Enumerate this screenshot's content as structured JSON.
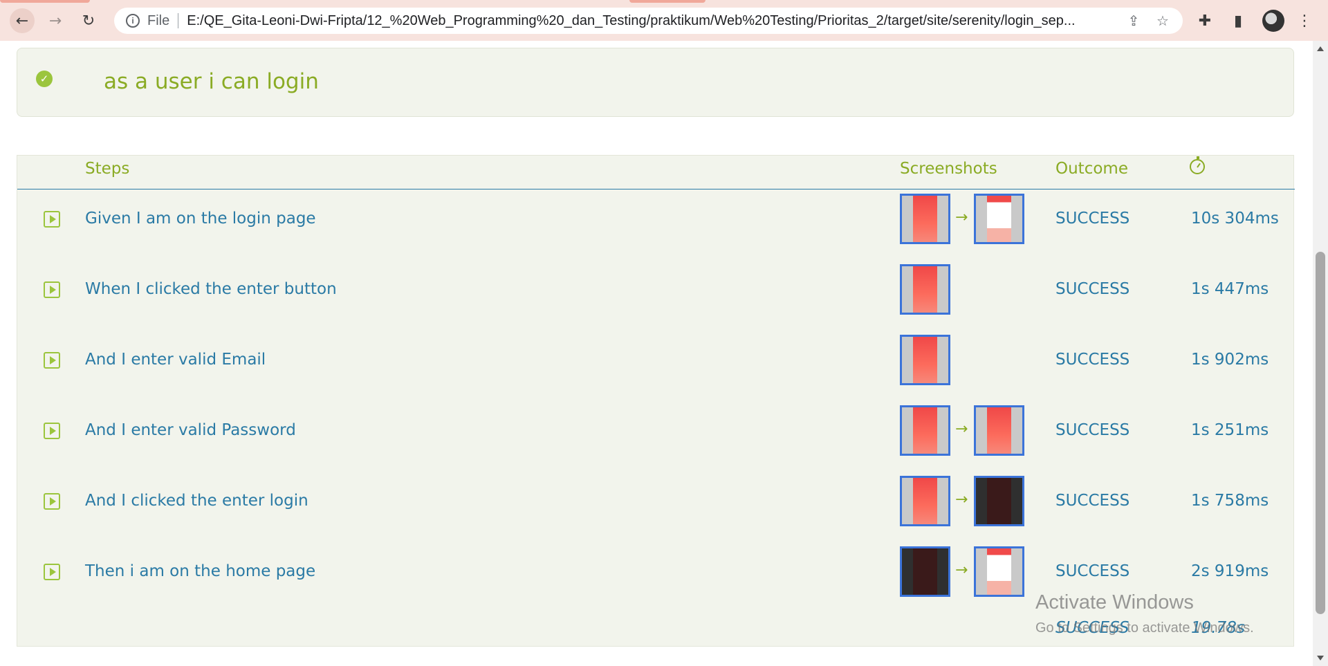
{
  "browser": {
    "file_label": "File",
    "url": "E:/QE_Gita-Leoni-Dwi-Fripta/12_%20Web_Programming%20_dan_Testing/praktikum/Web%20Testing/Prioritas_2/target/site/serenity/login_sep..."
  },
  "scenario": {
    "title": "as a user i can login"
  },
  "table": {
    "headers": {
      "steps": "Steps",
      "screenshots": "Screenshots",
      "outcome": "Outcome"
    },
    "rows": [
      {
        "step": "Given I am on the login page",
        "outcome": "SUCCESS",
        "duration": "10s 304ms"
      },
      {
        "step": "When I clicked the enter button",
        "outcome": "SUCCESS",
        "duration": "1s 447ms"
      },
      {
        "step": "And I enter valid Email",
        "outcome": "SUCCESS",
        "duration": "1s 902ms"
      },
      {
        "step": "And I enter valid Password",
        "outcome": "SUCCESS",
        "duration": "1s 251ms"
      },
      {
        "step": "And I clicked the enter login",
        "outcome": "SUCCESS",
        "duration": "1s 758ms"
      },
      {
        "step": "Then i am on the home page",
        "outcome": "SUCCESS",
        "duration": "2s 919ms"
      }
    ],
    "arrow": "→",
    "total": {
      "outcome": "SUCCESS",
      "duration": "19.78s"
    }
  },
  "watermark": {
    "line1": "Activate Windows",
    "line2": "Go to Settings to activate Windows."
  },
  "colors": {
    "accent_green": "#8aab24",
    "link_blue": "#2a7aa5",
    "panel_bg": "#f2f4ec"
  }
}
